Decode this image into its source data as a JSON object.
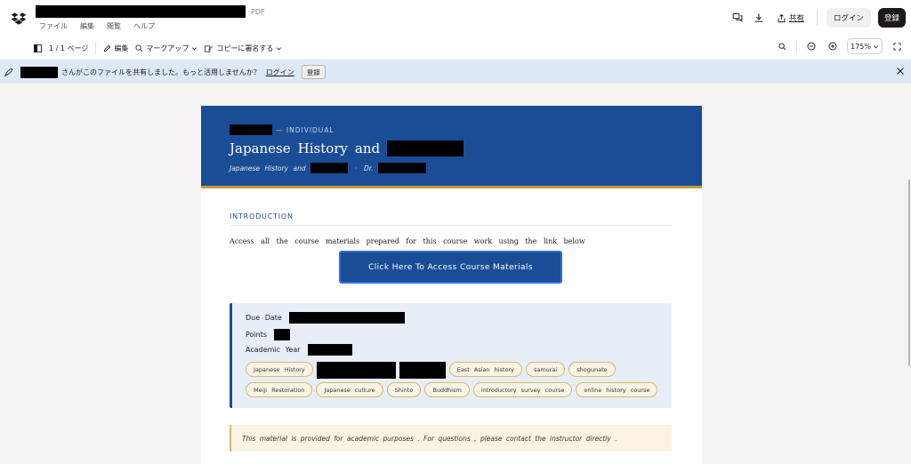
{
  "header": {
    "doc_title_redacted": true,
    "file_type": "PDF",
    "menu": [
      "ファイル",
      "編集",
      "閲覧",
      "ヘルプ"
    ],
    "share_label": "共有",
    "login_label": "ログイン",
    "register_label": "登録"
  },
  "toolbar": {
    "page_indicator": "1 / 1 ページ",
    "edit_label": "編集",
    "markup_label": "マークアップ",
    "sign_label": "コピーに署名する",
    "zoom_level": "175%"
  },
  "banner": {
    "message": "さんがこのファイルを共有しました。もっと活用しませんか？",
    "login_link": "ログイン",
    "register_button": "登録"
  },
  "document": {
    "kicker": "— INDIVIDUAL",
    "title_words": [
      "Japanese",
      "History",
      "and"
    ],
    "subtitle_prefix": "Japanese  History  and",
    "subtitle_sep": "·",
    "subtitle_dr": "Dr.",
    "section_label": "INTRODUCTION",
    "intro_text": "Access  all  the  course  materials   prepared   for  this  course  work  using  the  link  below",
    "cta_label": "Click Here To Access Course Materials",
    "due_date_label": "Due  Date",
    "points_label": "Points",
    "academic_year_label": "Academic   Year",
    "tags_row1": [
      "Japanese  History"
    ],
    "tags_row1b": [
      "East Asian  history",
      "samurai",
      "shogunate"
    ],
    "tags_row2": [
      "Meiji  Restoration",
      "Japanese  culture",
      "Shinto",
      "Buddhism",
      "introductory   survey  course",
      "online  history  course"
    ],
    "notice": "This  material is provided  for academic  purposes . For questions , please contact  the instructor  directly ."
  },
  "colors": {
    "brand_blue": "#1a4d96",
    "gold_accent": "#c79b3b",
    "banner_bg": "#dee9f7"
  }
}
